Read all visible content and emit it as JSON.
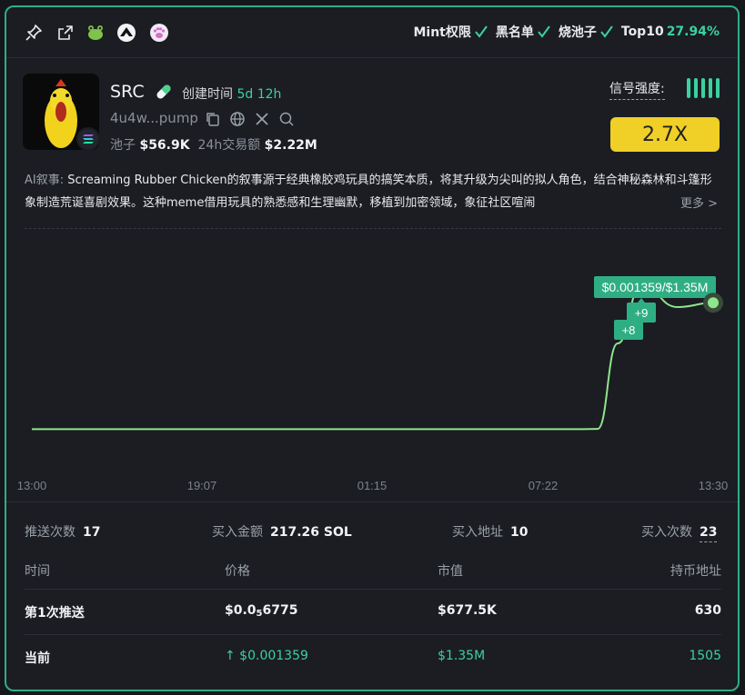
{
  "topbar": {
    "icons": [
      "pin-icon",
      "external-link-icon",
      "frog-icon",
      "mountain-icon",
      "paw-icon"
    ],
    "checks": [
      {
        "label": "Mint权限",
        "ok": true
      },
      {
        "label": "黑名单",
        "ok": true
      },
      {
        "label": "烧池子",
        "ok": true
      }
    ],
    "top10_label": "Top10",
    "top10_value": "27.94%"
  },
  "token": {
    "symbol": "SRC",
    "created_label": "创建时间",
    "created_value": "5d 12h",
    "address": "4u4w...pump",
    "pool_label": "池子",
    "pool_value": "$56.9K",
    "volume_label": "24h交易额",
    "volume_value": "$2.22M",
    "signal_label": "信号强度:",
    "signal_level": 5,
    "multiplier": "2.7X"
  },
  "narrative": {
    "label": "AI叙事:",
    "text": "Screaming Rubber Chicken的叙事源于经典橡胶鸡玩具的搞笑本质，将其升级为尖叫的拟人角色，结合神秘森林和斗篷形象制造荒诞喜剧效果。这种meme借用玩具的熟悉感和生理幽默，移植到加密领域，象征社区喧闹",
    "more": "更多 >"
  },
  "chart_data": {
    "type": "line",
    "x_ticks": [
      "13:00",
      "19:07",
      "01:15",
      "07:22",
      "13:30"
    ],
    "y_rel": [
      0.01,
      0.01,
      0.01,
      0.01,
      0.01,
      0.01,
      0.01,
      0.01,
      0.012,
      0.6,
      1.0,
      0.85,
      0.88
    ],
    "tooltip": "$0.001359/$1.35M",
    "markers": [
      "+8",
      "+9"
    ],
    "line_color": "#8ee68a"
  },
  "stats": {
    "push_label": "推送次数",
    "push_value": "17",
    "buy_amount_label": "买入金额",
    "buy_amount_value": "217.26 SOL",
    "buy_addr_label": "买入地址",
    "buy_addr_value": "10",
    "buy_count_label": "买入次数",
    "buy_count_value": "23"
  },
  "table": {
    "headers": [
      "时间",
      "价格",
      "市值",
      "持币地址"
    ],
    "rows": [
      {
        "time": "第1次推送",
        "price_prefix": "$0.0",
        "price_sub": "5",
        "price_rest": "6775",
        "mcap": "$677.5K",
        "holders": "630"
      },
      {
        "time": "当前",
        "price": "↑ $0.001359",
        "mcap": "$1.35M",
        "holders": "1505"
      }
    ]
  }
}
